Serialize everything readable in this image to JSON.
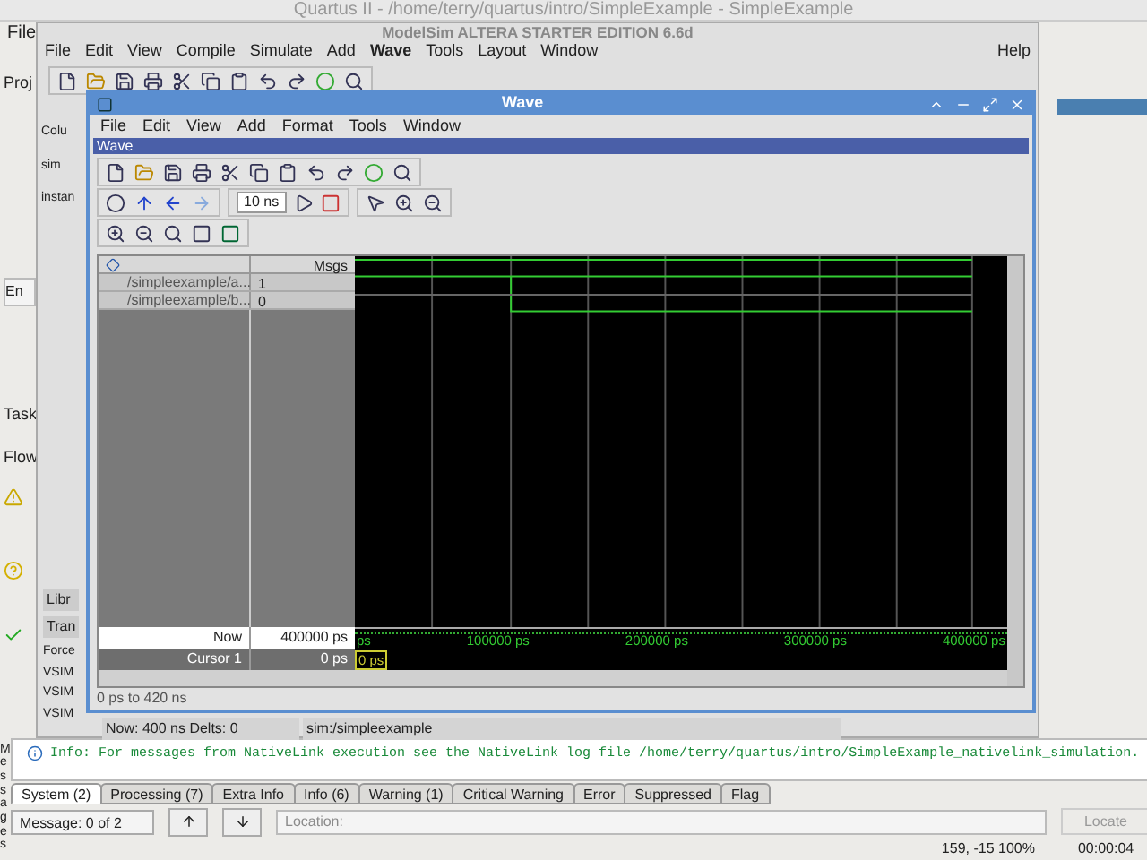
{
  "quartus": {
    "title": "Quartus II - /home/terry/quartus/intro/SimpleExample - SimpleExample",
    "menu": [
      "File"
    ],
    "sidebar_labels": [
      "Proj",
      "En",
      "Task",
      "Flow"
    ],
    "transcript": {
      "tab": "Tran",
      "lines": [
        "Force",
        "VSIM",
        "VSIM",
        "VSIM"
      ]
    },
    "messages": {
      "vertical_label": "Messages",
      "info": "Info: For messages from NativeLink execution see the NativeLink log file /home/terry/quartus/intro/SimpleExample_nativelink_simulation.",
      "tabs": [
        {
          "label": "System (2)",
          "selected": true
        },
        {
          "label": "Processing (7)",
          "selected": false
        },
        {
          "label": "Extra Info",
          "selected": false
        },
        {
          "label": "Info (6)",
          "selected": false
        },
        {
          "label": "Warning (1)",
          "selected": false
        },
        {
          "label": "Critical Warning",
          "selected": false
        },
        {
          "label": "Error",
          "selected": false
        },
        {
          "label": "Suppressed",
          "selected": false
        },
        {
          "label": "Flag",
          "selected": false
        }
      ],
      "count": "Message: 0 of 2",
      "location_placeholder": "Location:",
      "locate": "Locate"
    },
    "status": {
      "coords": "159, -15 100%",
      "time": "00:00:04"
    }
  },
  "modelsim": {
    "title": "ModelSim ALTERA STARTER EDITION 6.6d",
    "menu": [
      {
        "label": "File",
        "bold": false
      },
      {
        "label": "Edit",
        "bold": false
      },
      {
        "label": "View",
        "bold": false
      },
      {
        "label": "Compile",
        "bold": false
      },
      {
        "label": "Simulate",
        "bold": false
      },
      {
        "label": "Add",
        "bold": false
      },
      {
        "label": "Wave",
        "bold": true
      },
      {
        "label": "Tools",
        "bold": false
      },
      {
        "label": "Layout",
        "bold": false
      },
      {
        "label": "Window",
        "bold": false
      }
    ],
    "help": "Help",
    "left_labels": [
      "Colu",
      "sim",
      "instan"
    ],
    "library_tab": "Libr",
    "status": {
      "now": "Now: 400 ns",
      "delts": "Delts: 0",
      "path": "sim:/simpleexample"
    }
  },
  "wave": {
    "title": "Wave",
    "menu": [
      "File",
      "Edit",
      "View",
      "Add",
      "Format",
      "Tools",
      "Window"
    ],
    "inner_title": "Wave",
    "time_step": "10 ns",
    "msgs_header": "Msgs",
    "signals": [
      {
        "name": "/simpleexample/a...",
        "value": "1"
      },
      {
        "name": "/simpleexample/b...",
        "value": "0"
      }
    ],
    "now_label": "Now",
    "now_value": "400000 ps",
    "cursor_label": "Cursor 1",
    "cursor_value": "0 ps",
    "cursor_flag": "0 ps",
    "ticks": [
      "ps",
      "100000 ps",
      "200000 ps",
      "300000 ps",
      "400000 ps"
    ],
    "range": "0 ps to 420 ns"
  }
}
